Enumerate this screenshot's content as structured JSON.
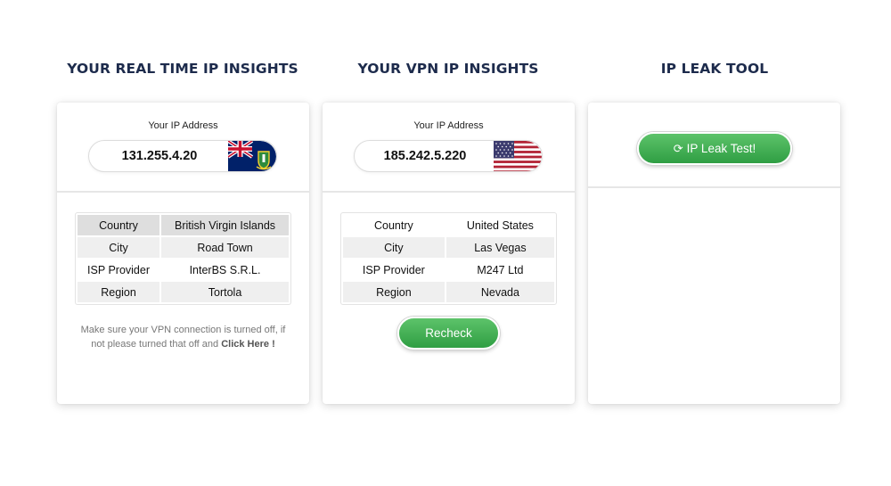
{
  "columns": [
    {
      "title": "YOUR REAL TIME IP INSIGHTS",
      "ip_label": "Your IP Address",
      "ip_value": "131.255.4.20",
      "flag_icon": "british-virgin-islands-flag-icon",
      "rows": [
        {
          "key": "Country",
          "value": "British Virgin Islands"
        },
        {
          "key": "City",
          "value": "Road Town"
        },
        {
          "key": "ISP Provider",
          "value": "InterBS S.R.L."
        },
        {
          "key": "Region",
          "value": "Tortola"
        }
      ],
      "note_text": "Make sure your VPN connection is turned off, if not please turned that off and ",
      "note_link": "Click Here",
      "note_end": " !"
    },
    {
      "title": "YOUR VPN IP INSIGHTS",
      "ip_label": "Your IP Address",
      "ip_value": "185.242.5.220",
      "flag_icon": "united-states-flag-icon",
      "rows": [
        {
          "key": "Country",
          "value": "United States"
        },
        {
          "key": "City",
          "value": "Las Vegas"
        },
        {
          "key": "ISP Provider",
          "value": "M247 Ltd"
        },
        {
          "key": "Region",
          "value": "Nevada"
        }
      ],
      "button_label": "Recheck"
    },
    {
      "title": "IP LEAK TOOL",
      "button_icon": "refresh-icon",
      "button_label": "IP Leak Test!"
    }
  ],
  "colors": {
    "title": "#1d2b4c",
    "button_green": "#3aa84b"
  }
}
